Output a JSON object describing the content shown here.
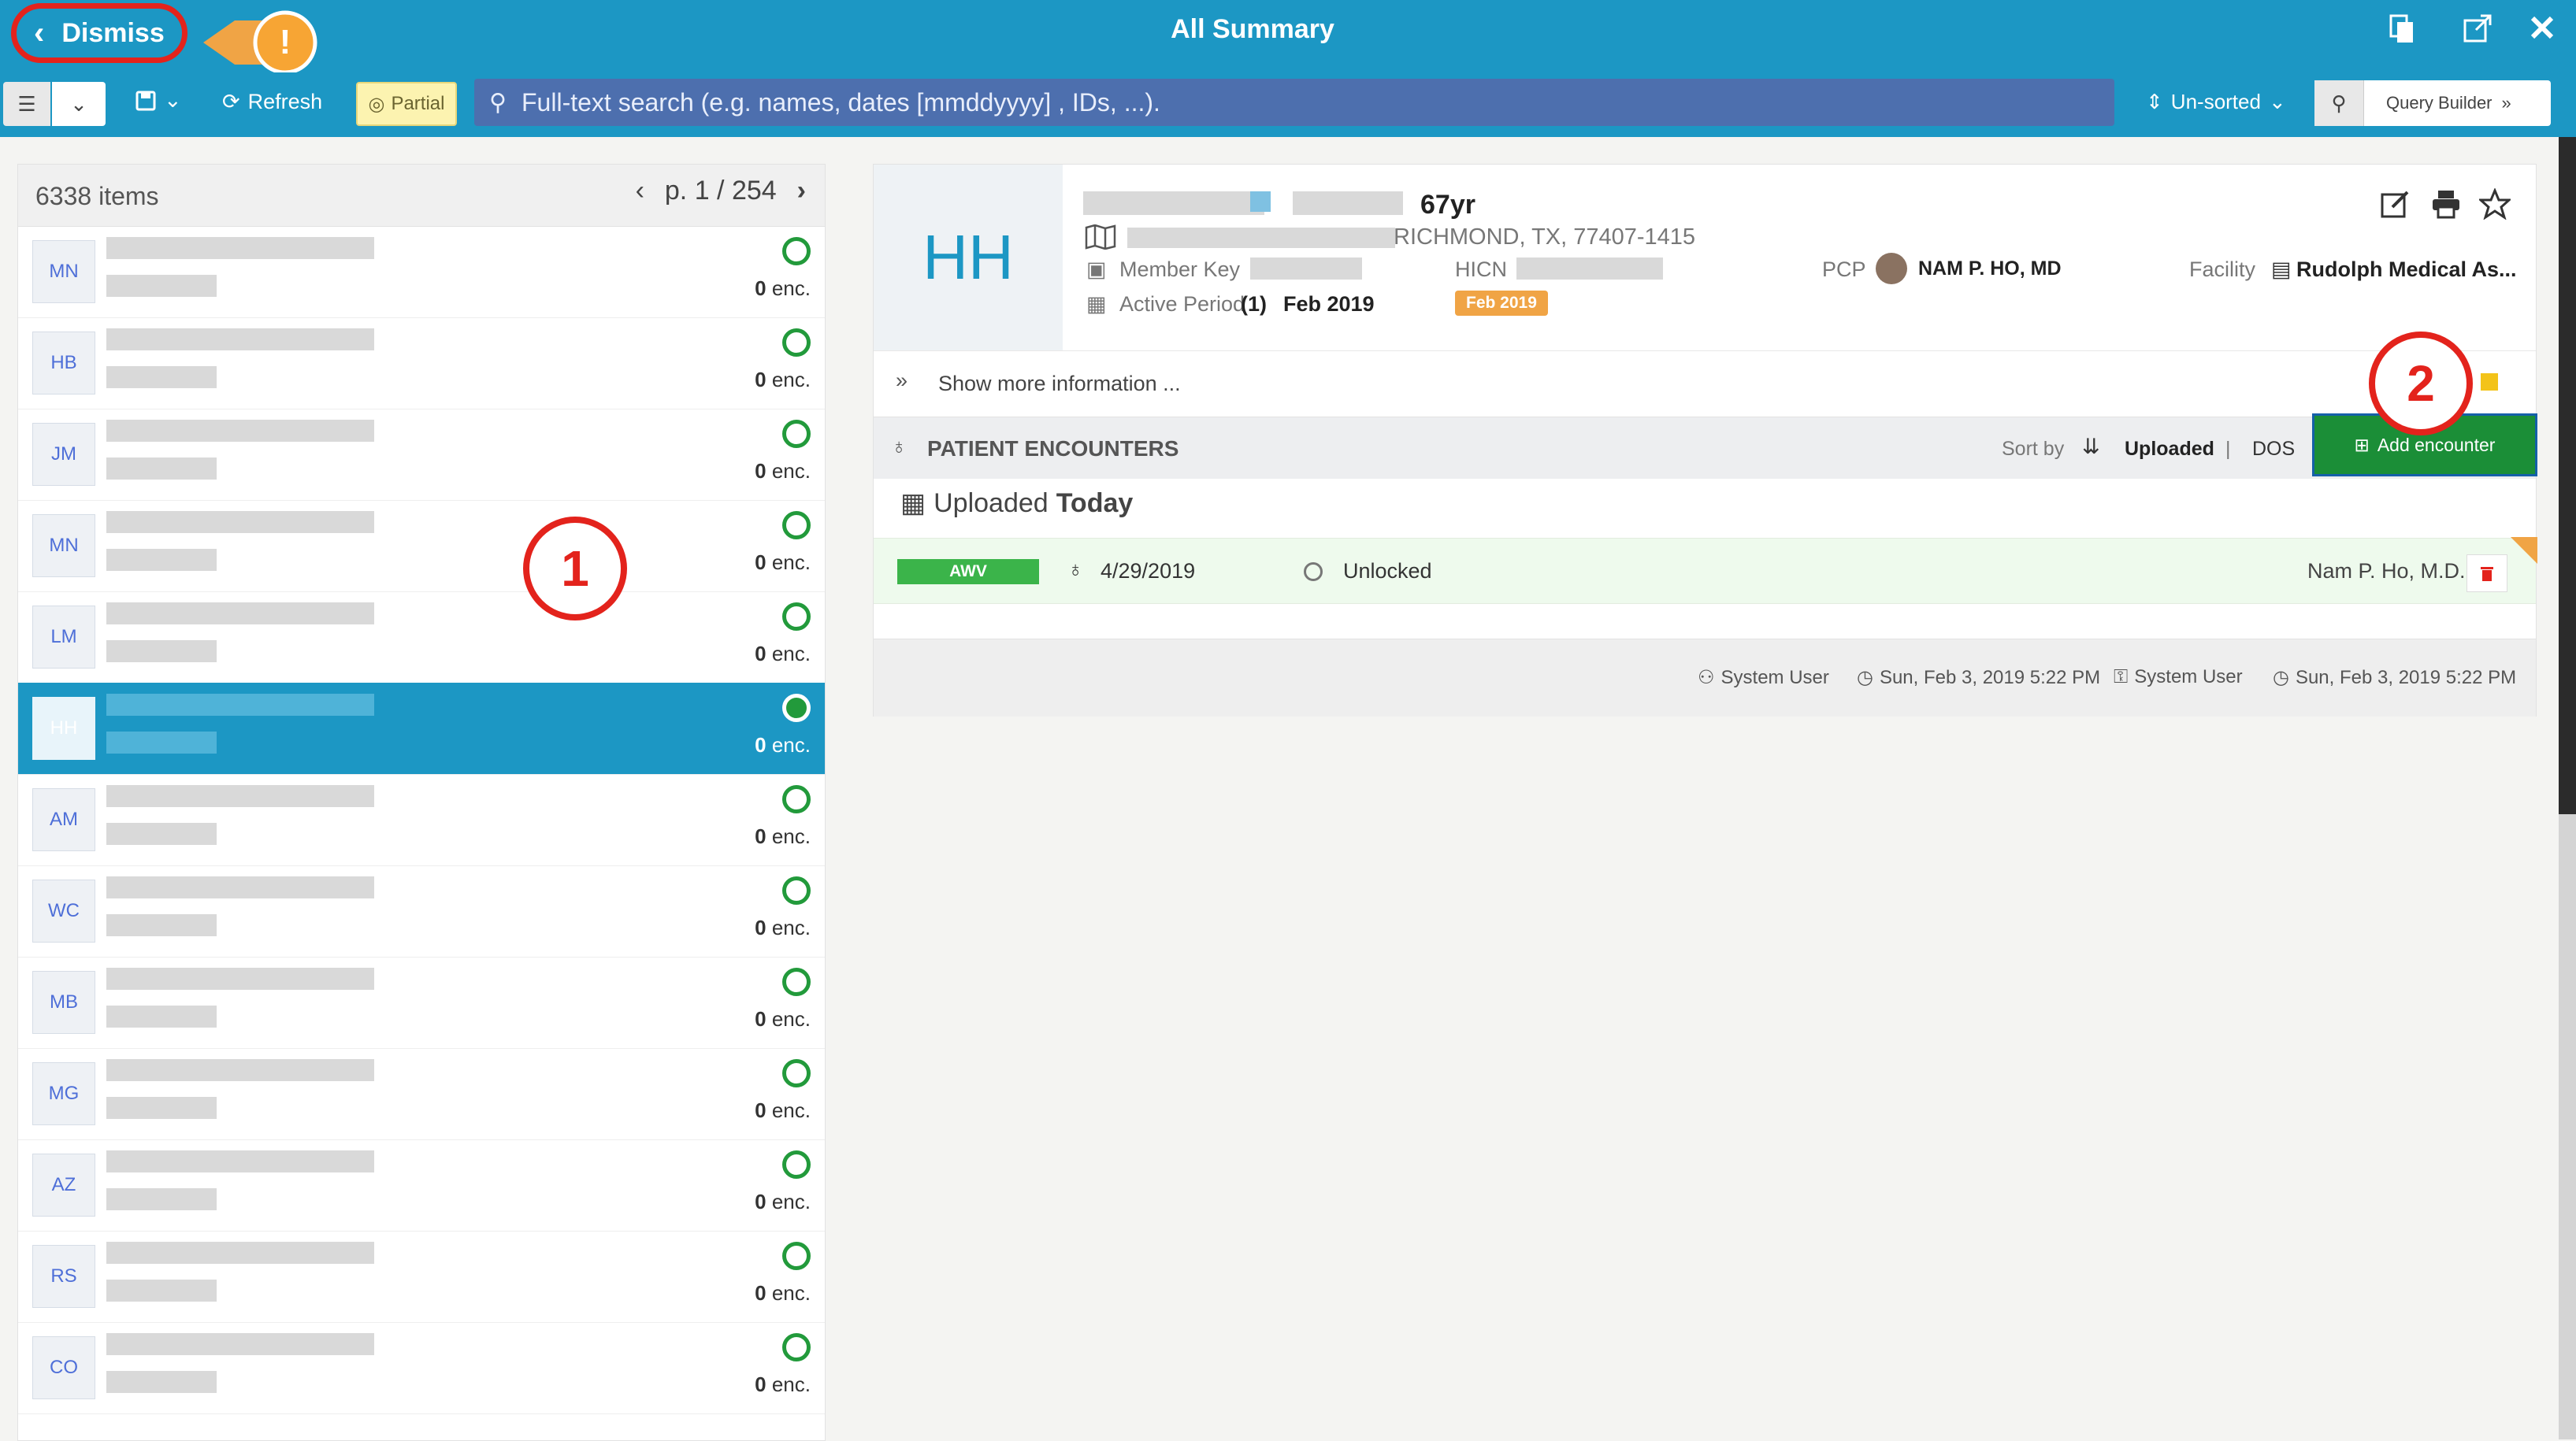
{
  "topbar": {
    "dismiss_label": "Dismiss",
    "title": "All Summary",
    "alert_symbol": "!",
    "icons": [
      "copy-icon",
      "external-link-icon",
      "close-icon"
    ]
  },
  "toolbar": {
    "refresh_label": "Refresh",
    "partial_label": "Partial",
    "search_placeholder": "Full-text search (e.g. names, dates [mmddyyyy] , IDs, ...).",
    "sort_label": "Un-sorted",
    "query_builder_label": "Query Builder"
  },
  "list": {
    "count_label": "6338 items",
    "page_label": "p. 1 / 254",
    "enc_suffix": "enc.",
    "rows": [
      {
        "initials": "MN",
        "enc": "0"
      },
      {
        "initials": "HB",
        "enc": "0"
      },
      {
        "initials": "JM",
        "enc": "0"
      },
      {
        "initials": "MN",
        "enc": "0"
      },
      {
        "initials": "LM",
        "enc": "0"
      },
      {
        "initials": "HH",
        "enc": "0"
      },
      {
        "initials": "AM",
        "enc": "0"
      },
      {
        "initials": "WC",
        "enc": "0"
      },
      {
        "initials": "MB",
        "enc": "0"
      },
      {
        "initials": "MG",
        "enc": "0"
      },
      {
        "initials": "AZ",
        "enc": "0"
      },
      {
        "initials": "RS",
        "enc": "0"
      },
      {
        "initials": "CO",
        "enc": "0"
      }
    ]
  },
  "annotations": {
    "callout_1": "1",
    "callout_2": "2"
  },
  "patient": {
    "initials": "HH",
    "age": "67yr",
    "address": "RICHMOND, TX, 77407-1415",
    "member_key_label": "Member Key",
    "hicn_label": "HICN",
    "active_period_label": "Active Period",
    "active_period_count": "(1)",
    "active_period_value": "Feb 2019",
    "hicn_badge": "Feb 2019",
    "pcp_label": "PCP",
    "pcp_name": "NAM P. HO, MD",
    "facility_label": "Facility",
    "facility_name": "Rudolph Medical As..."
  },
  "show_more_label": "Show more information ...",
  "encounters": {
    "section_title": "PATIENT ENCOUNTERS",
    "sort_by_label": "Sort by",
    "sort_uploaded": "Uploaded",
    "sort_separator": "|",
    "sort_dos": "DOS",
    "add_label": "Add encounter",
    "group_prefix": "Uploaded",
    "group_suffix": "Today",
    "row": {
      "type": "AWV",
      "date": "4/29/2019",
      "status": "Unlocked",
      "provider": "Nam P. Ho, M.D."
    },
    "footer": {
      "created_by": "System User",
      "created_at": "Sun, Feb 3, 2019 5:22 PM",
      "locked_by": "System User",
      "locked_at": "Sun, Feb 3, 2019 5:22 PM"
    }
  },
  "colors": {
    "brand": "#1c97c4",
    "search_bg": "#4d6fae",
    "add_button": "#1b8e37",
    "callout": "#e3231c",
    "awv_badge": "#3bb44a",
    "period_badge": "#f0a445"
  }
}
